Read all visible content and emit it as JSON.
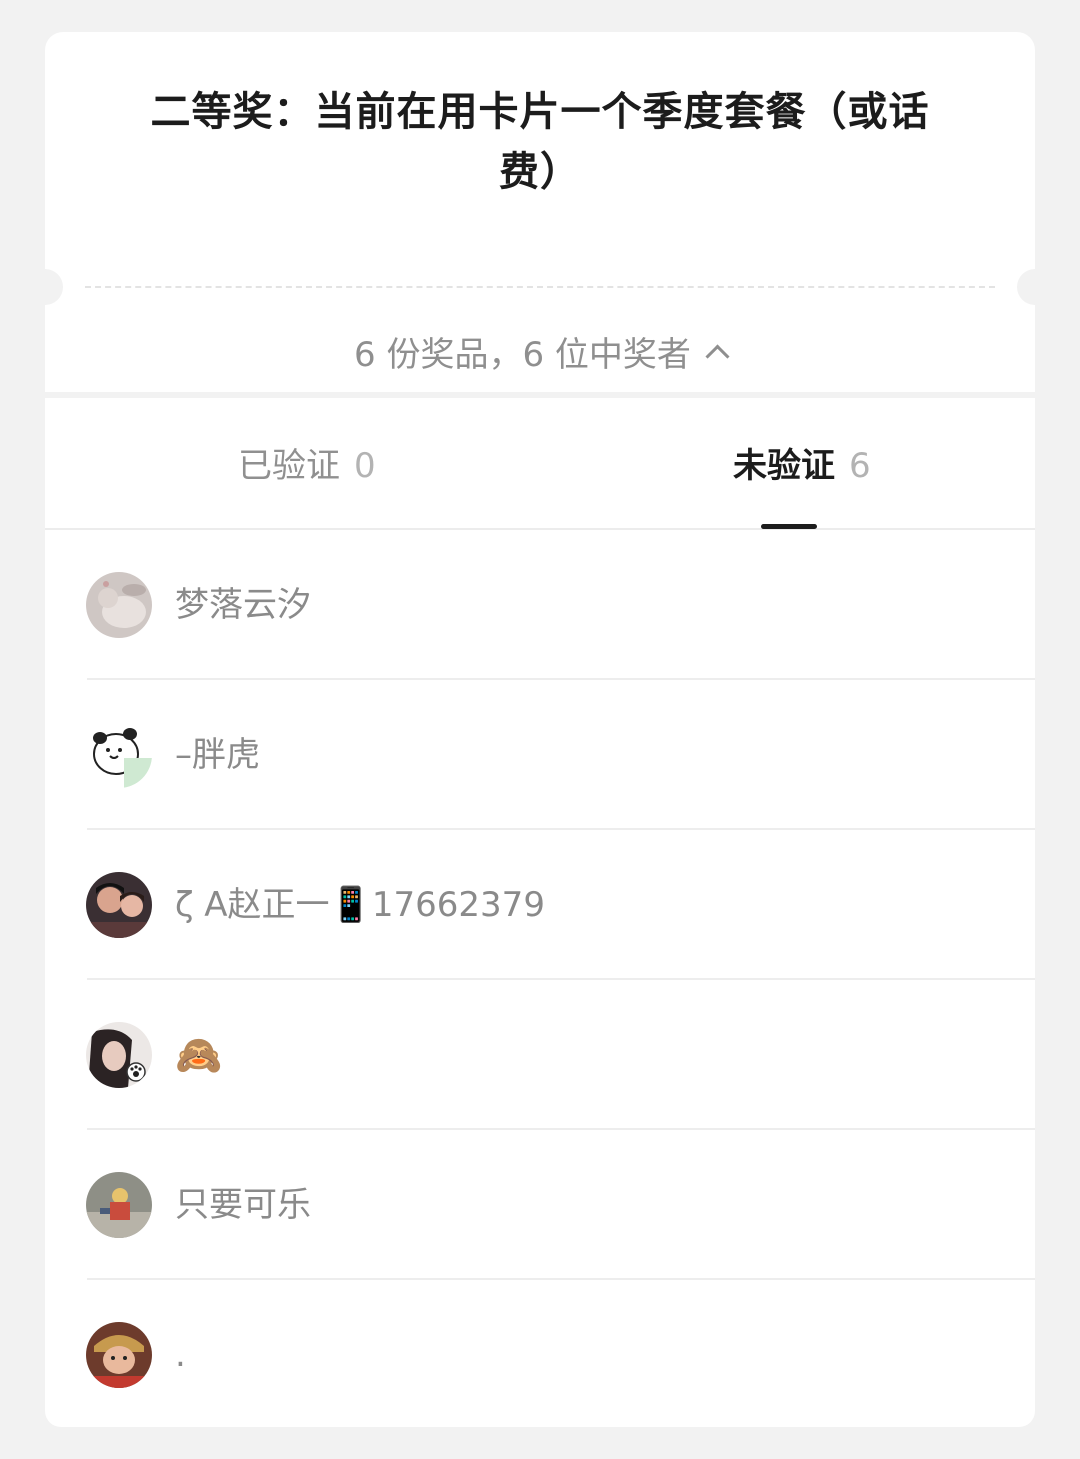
{
  "prize": {
    "title": "二等奖：当前在用卡片一个季度套餐（或话费）",
    "summary": "6 份奖品，6 位中奖者",
    "expand_icon": "chevron-up-icon"
  },
  "tabs": [
    {
      "label": "已验证",
      "count": "0",
      "active": false
    },
    {
      "label": "未验证",
      "count": "6",
      "active": true
    }
  ],
  "winners": [
    {
      "name": "梦落云汐",
      "avatar": "avatar-photo-pet"
    },
    {
      "name": "–胖虎",
      "avatar": "avatar-cartoon-panda"
    },
    {
      "name": "ζ A赵正一📱17662379",
      "avatar": "avatar-photo-couple"
    },
    {
      "name": "🙈",
      "avatar": "avatar-photo-girl"
    },
    {
      "name": "只要可乐",
      "avatar": "avatar-photo-toy"
    },
    {
      "name": ".",
      "avatar": "avatar-photo-monkey-king"
    }
  ],
  "colors": {
    "background": "#f2f2f2",
    "card": "#ffffff",
    "title_text": "#1c1c1c",
    "muted_text": "#8f8f8f",
    "tab_indicator": "#1c1c1c"
  }
}
